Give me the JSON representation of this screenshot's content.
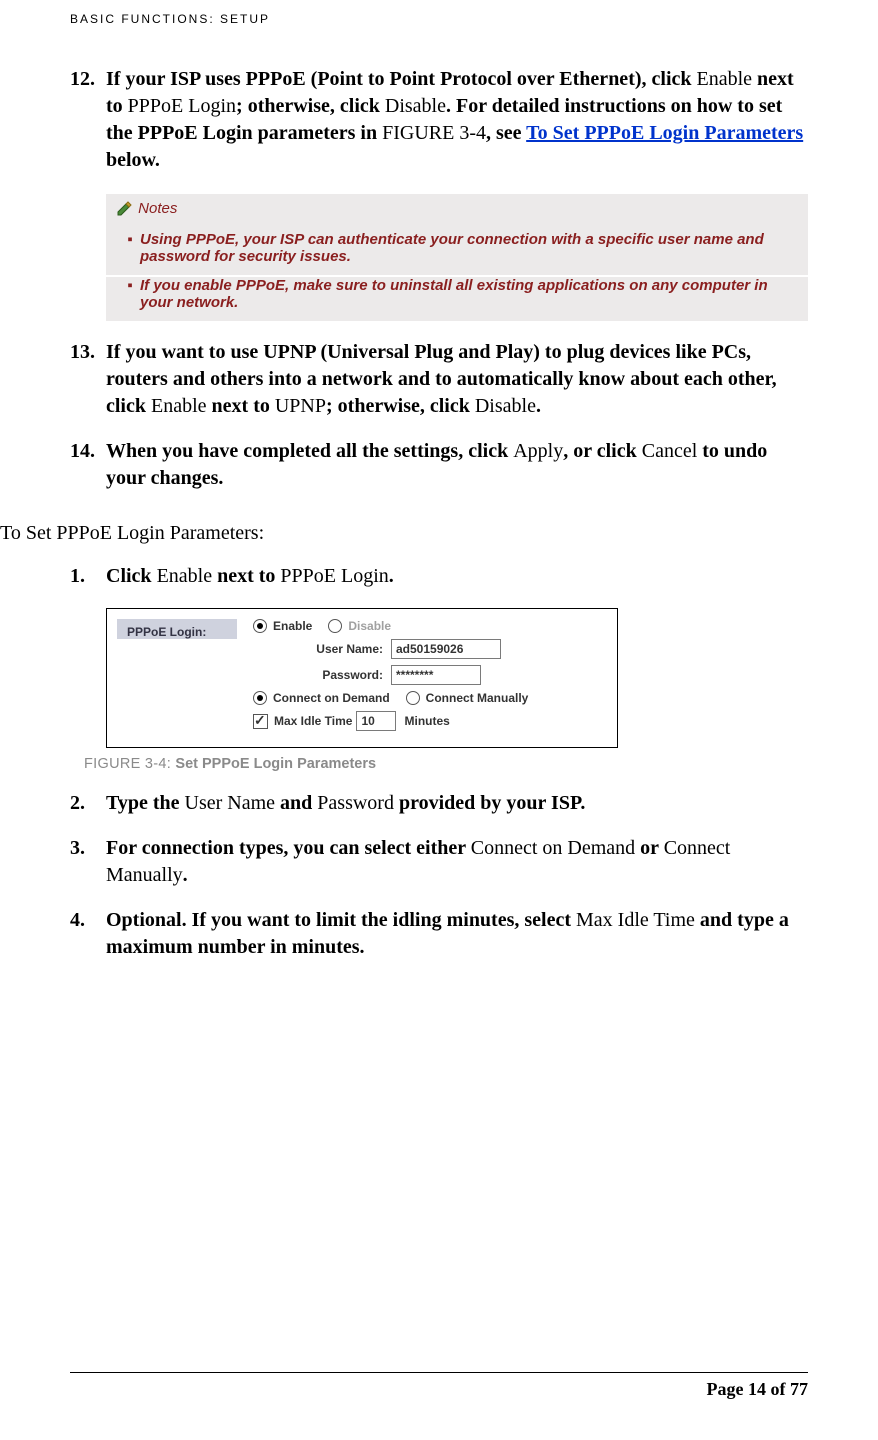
{
  "header": "BASIC FUNCTIONS: SETUP",
  "steps12": {
    "num": "12.",
    "t1": "If your ISP uses PPPoE (Point to Point Protocol over Ethernet), click ",
    "r1": "Enable",
    "t2": " next to ",
    "r2": "PPPoE Login",
    "t3": "; otherwise, click ",
    "r3": "Disable",
    "t4": ". For detailed instructions on how to set the PPPoE Login parameters in ",
    "r4": "FIGURE 3-4",
    "t5": ", see ",
    "link": "To Set PPPoE Login Parameters",
    "t6": " below."
  },
  "notes": {
    "title": "Notes",
    "items": [
      "Using PPPoE, your ISP can authenticate your connection with a specific user name and password for security issues.",
      "If you enable PPPoE, make sure to uninstall all existing applications on any computer in your network."
    ]
  },
  "steps13": {
    "num": "13.",
    "t1": "If you want to use UPNP (Universal Plug and Play) to plug devices like PCs, routers and others into a network and to automatically know about each other, click ",
    "r1": "Enable",
    "t2": " next to ",
    "r2": "UPNP",
    "t3": "; otherwise, click ",
    "r3": "Disable",
    "t4": "."
  },
  "steps14": {
    "num": "14.",
    "t1": "When you have completed all the settings, click ",
    "r1": "Apply",
    "t2": ", or click ",
    "r2": "Cancel",
    "t3": " to undo your changes."
  },
  "section_heading": "To Set PPPoE Login Parameters:",
  "sub1": {
    "num": "1.",
    "t1": "Click ",
    "r1": "Enable",
    "t2": " next to ",
    "r2": "PPPoE Login",
    "t3": "."
  },
  "figure": {
    "label": "PPPoE Login:",
    "enable": "Enable",
    "disable": "Disable",
    "user_label": "User Name:",
    "user_value": "ad50159026",
    "pass_label": "Password:",
    "pass_value": "********",
    "cod": "Connect on Demand",
    "cm": "Connect Manually",
    "idle_prefix": "Max Idle Time",
    "idle_value": "10",
    "idle_suffix": "Minutes"
  },
  "figure_caption": {
    "lead": "FIGURE 3-4: ",
    "title": "Set PPPoE Login Parameters"
  },
  "sub2": {
    "num": "2.",
    "t1": "Type the ",
    "r1": "User Name",
    "t2": " and ",
    "r2": "Password",
    "t3": " provided by your ISP."
  },
  "sub3": {
    "num": "3.",
    "t1": "For connection types, you can select either ",
    "r1": "Connect on Demand",
    "t2": " or ",
    "r2": "Connect Manually",
    "t3": "."
  },
  "sub4": {
    "num": "4.",
    "t1": "Optional. If you want to limit the idling minutes, select ",
    "r1": "Max Idle Time",
    "t2": " and type a maximum number in minutes."
  },
  "footer": "Page 14 of 77"
}
